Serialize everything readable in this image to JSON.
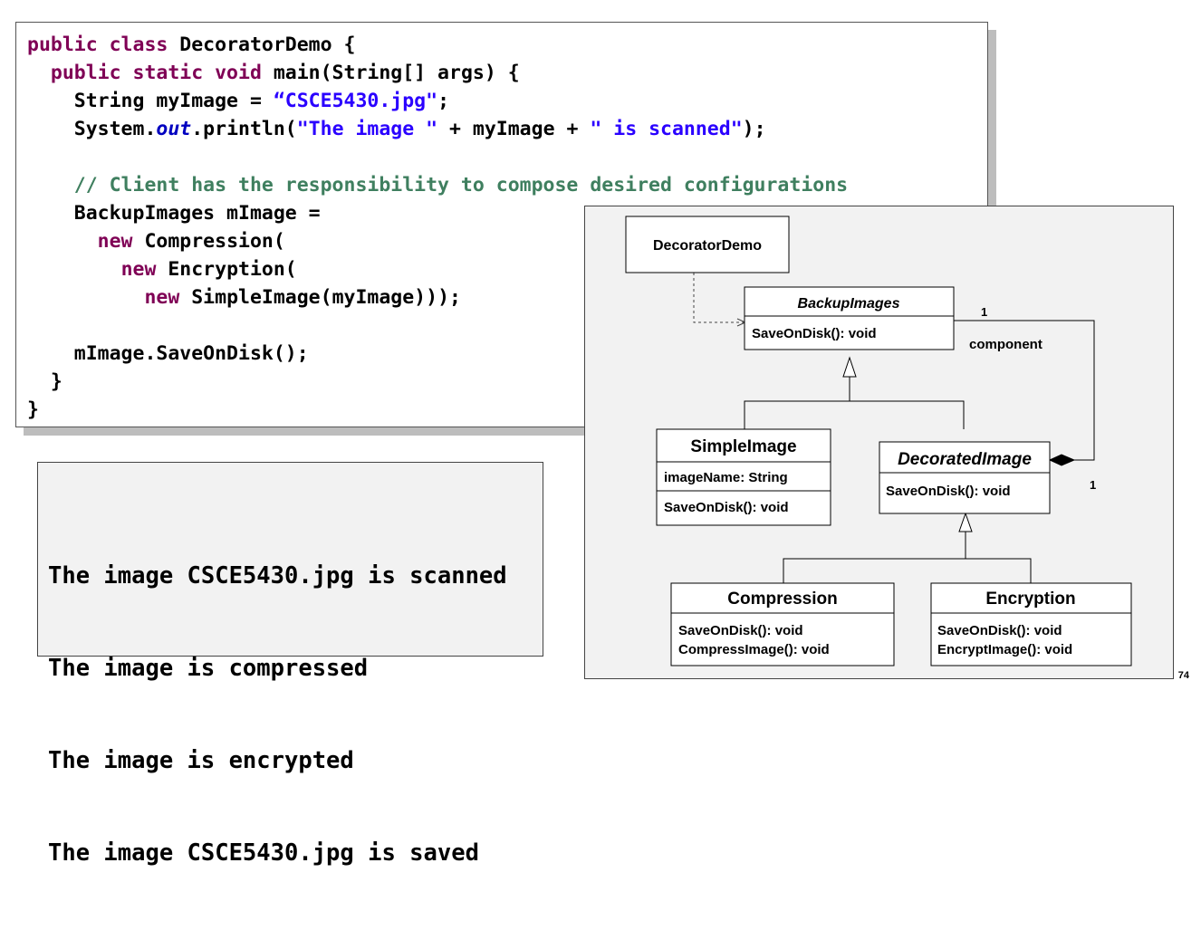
{
  "code": {
    "line1": {
      "kw": "public class",
      "rest": " DecoratorDemo {"
    },
    "line2": {
      "kw": "public static void",
      "rest": " main(String[] args) {"
    },
    "line3": {
      "pre": "String myImage = ",
      "str": "“CSCE5430.jpg\"",
      "post": ";"
    },
    "line4": {
      "pre": "System.",
      "field": "out",
      "mid": ".println(",
      "str1": "\"The image \"",
      "mid2": " + myImage + ",
      "str2": "\" is scanned\"",
      "post": ");"
    },
    "line5": {
      "comment": "// Client has the responsibility to compose desired configurations"
    },
    "line6": "BackupImages mImage =",
    "line7": {
      "kw": "new",
      "rest": " Compression("
    },
    "line8": {
      "kw": "new",
      "rest": " Encryption("
    },
    "line9": {
      "kw": "new",
      "rest": " SimpleImage(myImage)));"
    },
    "line10": "mImage.SaveOnDisk();",
    "line11": "}",
    "line12": "}"
  },
  "output": {
    "lines": [
      "The image CSCE5430.jpg is scanned",
      "The image is compressed",
      "The image is encrypted",
      "The image CSCE5430.jpg is saved"
    ]
  },
  "uml": {
    "demo": {
      "name": "DecoratorDemo"
    },
    "backup": {
      "name": "BackupImages",
      "method": "SaveOnDisk(): void"
    },
    "simple": {
      "name": "SimpleImage",
      "attr": "imageName: String",
      "method": "SaveOnDisk(): void"
    },
    "decorated": {
      "name": "DecoratedImage",
      "method": "SaveOnDisk(): void"
    },
    "compression": {
      "name": "Compression",
      "method1": "SaveOnDisk(): void",
      "method2": "CompressImage(): void"
    },
    "encryption": {
      "name": "Encryption",
      "method1": "SaveOnDisk(): void",
      "method2": "EncryptImage(): void"
    },
    "assoc": {
      "mult_top": "1",
      "role": "component",
      "mult_bottom": "1"
    }
  },
  "page_number": "74"
}
